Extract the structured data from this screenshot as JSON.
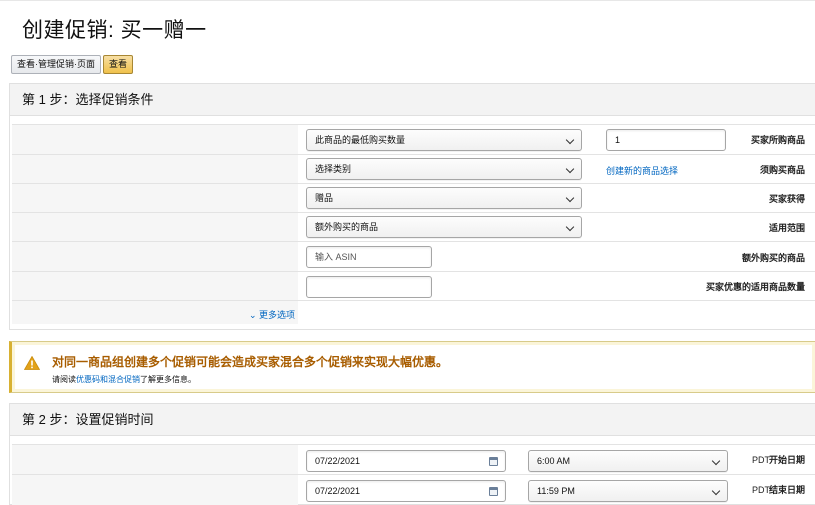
{
  "page": {
    "title": "创建促销: 买一赠一"
  },
  "toolbar": {
    "manage_label": "查看·管理促销·页面",
    "view_label": "查看"
  },
  "step1": {
    "title": "第 1 步：选择促销条件",
    "rows": {
      "buyer_buys": {
        "label": "买家所购商品",
        "select": "此商品的最低购买数量",
        "value": "1"
      },
      "required": {
        "label": "须购买商品",
        "select": "选择类别",
        "link": "创建新的商品选择"
      },
      "buyer_gets": {
        "label": "买家获得",
        "select": "赠品"
      },
      "applies_to": {
        "label": "适用范围",
        "select": "额外购买的商品"
      },
      "extra_item": {
        "label": "额外购买的商品",
        "placeholder": "输入 ASIN"
      },
      "qty": {
        "label": "买家优惠的适用商品数量",
        "value": ""
      }
    },
    "more_options": "更多选项"
  },
  "alert": {
    "title": "对同一商品组创建多个促销可能会造成买家混合多个促销来实现大幅优惠。",
    "desc_prefix": "请阅读",
    "desc_link": "优惠码和混合促销",
    "desc_suffix": "了解更多信息。"
  },
  "step2": {
    "title": "第 2 步：设置促销时间",
    "start": {
      "label": "开始日期",
      "date": "07/22/2021",
      "time": "6:00 AM",
      "tz": "PDT"
    },
    "end": {
      "label": "结束日期",
      "date": "07/22/2021",
      "time": "11:59 PM",
      "tz": "PDT"
    }
  },
  "colors": {
    "link": "#0066c0",
    "warning": "#a85d00",
    "primary_button": "#f0c14b"
  }
}
